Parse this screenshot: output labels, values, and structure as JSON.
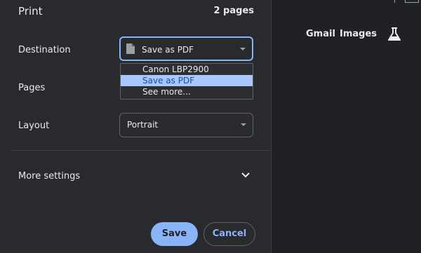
{
  "dialog": {
    "title": "Print",
    "page_count": "2 pages"
  },
  "destination": {
    "label": "Destination",
    "selected": "Save as PDF",
    "options": [
      "Canon LBP2900",
      "Save as PDF",
      "See more..."
    ]
  },
  "pages": {
    "label": "Pages"
  },
  "layout": {
    "label": "Layout",
    "selected": "Portrait"
  },
  "more_settings": {
    "label": "More settings"
  },
  "buttons": {
    "save": "Save",
    "cancel": "Cancel"
  },
  "preview_page": {
    "links": [
      "Gmail",
      "Images"
    ],
    "icons": [
      "labs-flask-icon"
    ]
  },
  "colors": {
    "accent": "#8ab4f8",
    "panel": "#292a2d",
    "background": "#202124",
    "option_highlight": "#a8c7fa"
  }
}
